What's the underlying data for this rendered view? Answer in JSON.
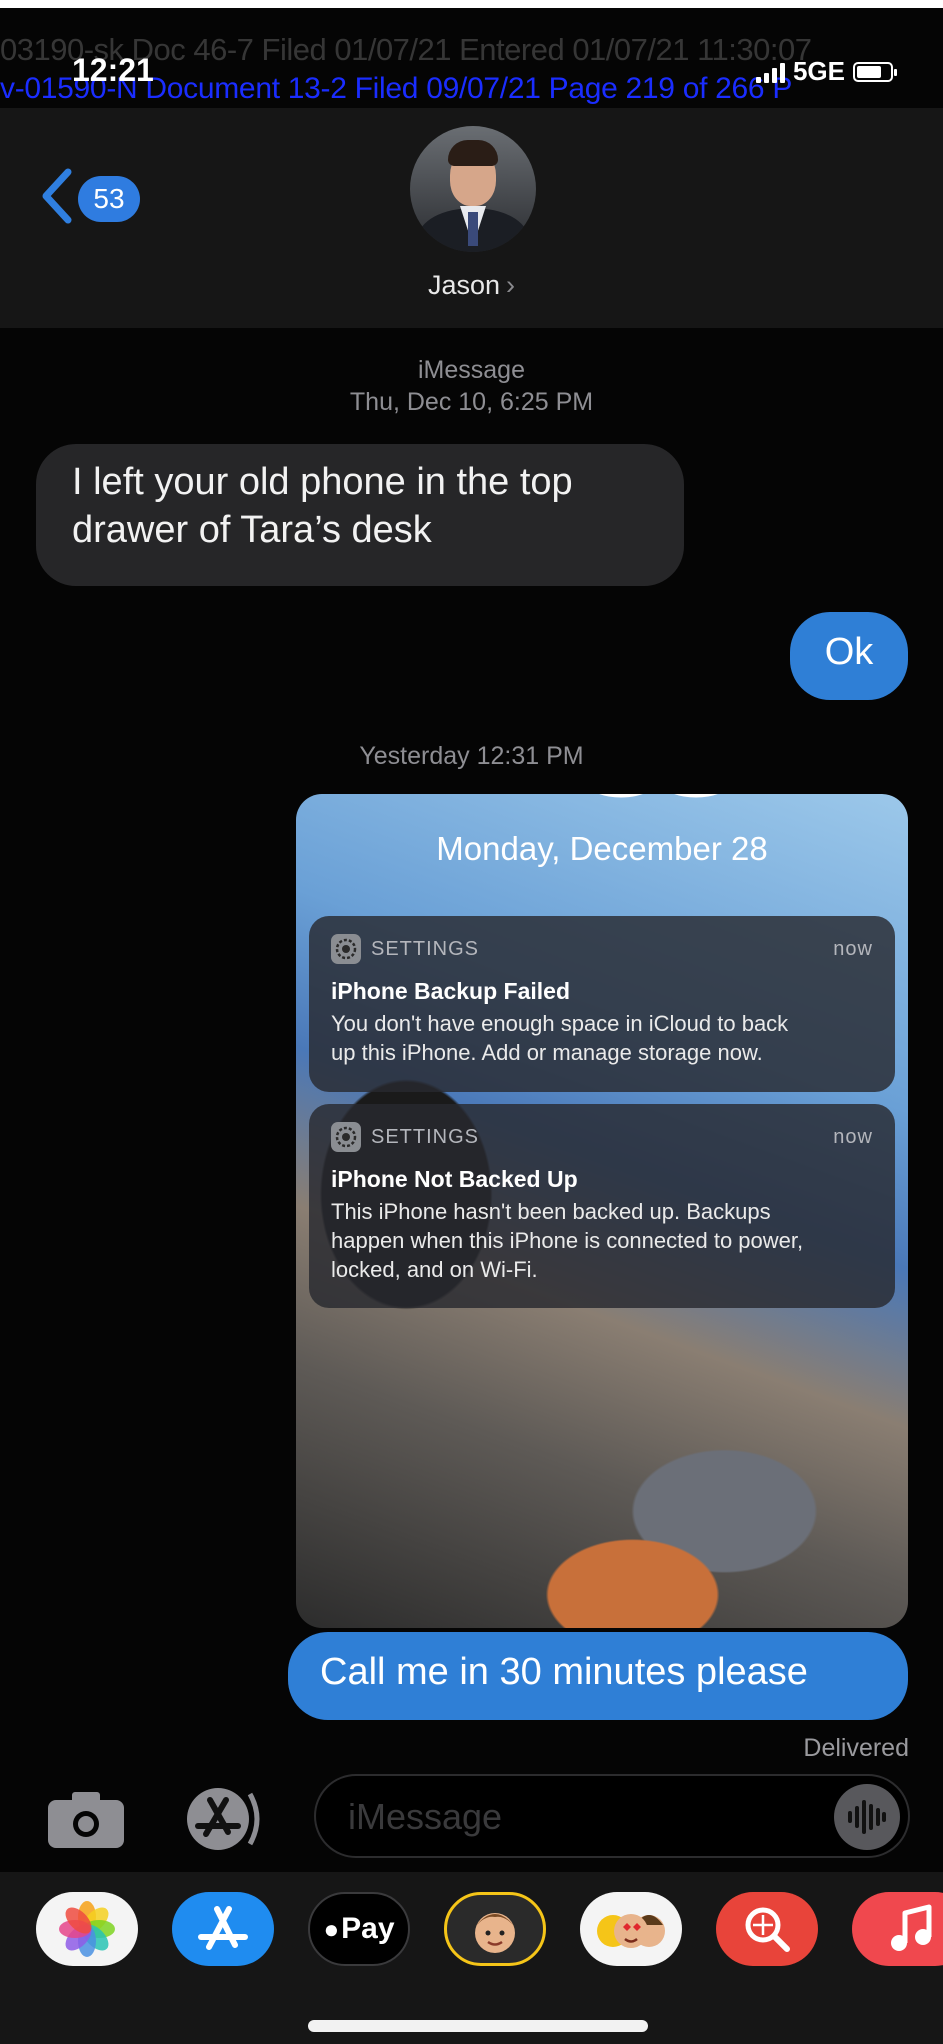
{
  "stamp": {
    "line1": "03190-sk Doc 46-7 Filed 01/07/21 Entered 01/07/21 11:30:07",
    "line2": "v-01590-N   Document 13-2   Filed 09/07/21   Page 219 of 266   P"
  },
  "status_bar": {
    "time": "12:21",
    "network": "5GE"
  },
  "header": {
    "back_count": "53",
    "contact_name": "Jason"
  },
  "conversation": {
    "service": "iMessage",
    "timestamp1": "Thu, Dec 10, 6:25 PM",
    "msg_in_1_line1": "I left your old phone in the top",
    "msg_in_1_line2": "drawer of Tara’s desk",
    "msg_out_1": "Ok",
    "timestamp2": "Yesterday 12:31 PM",
    "screenshot": {
      "date": "Monday, December 28",
      "notifications": [
        {
          "app": "SETTINGS",
          "time": "now",
          "title": "iPhone Backup Failed",
          "body_line1": "You don't have enough space in iCloud to back",
          "body_line2": "up this iPhone. Add or manage storage now."
        },
        {
          "app": "SETTINGS",
          "time": "now",
          "title": "iPhone Not Backed Up",
          "body_line1": "This iPhone hasn't been backed up. Backups",
          "body_line2": "happen when this iPhone is connected to power,",
          "body_line3": "locked, and on Wi-Fi."
        }
      ]
    },
    "msg_out_2": "Call me in 30 minutes please",
    "delivered": "Delivered"
  },
  "input": {
    "placeholder": "iMessage"
  },
  "drawer": {
    "apple_pay_label": "Pay"
  },
  "colors": {
    "accent_blue": "#2f7fd6",
    "incoming_bubble": "#262628",
    "background": "#050505"
  }
}
